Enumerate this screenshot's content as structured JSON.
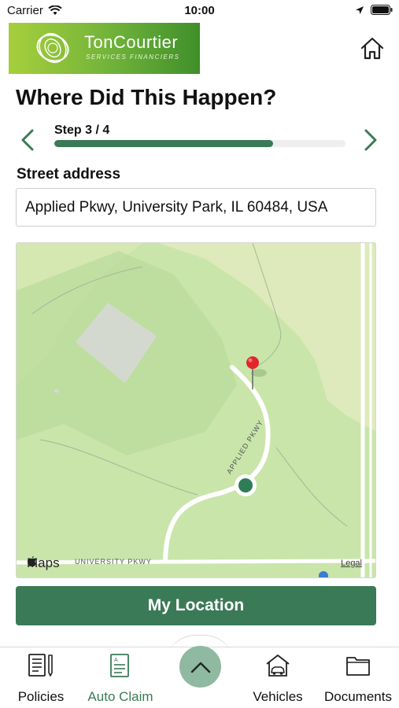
{
  "status_bar": {
    "carrier": "Carrier",
    "time": "10:00"
  },
  "header": {
    "logo_name": "TonCourtier",
    "logo_tagline": "SERVICES FINANCIERS"
  },
  "page": {
    "title": "Where Did This Happen?",
    "step_label": "Step 3 / 4",
    "progress_fraction": 0.75
  },
  "address": {
    "label": "Street address",
    "value": "Applied Pkwy, University Park, IL 60484, USA"
  },
  "map": {
    "provider_label": "Maps",
    "legal_label": "Legal",
    "road_labels": {
      "university": "UNIVERSITY PKWY",
      "applied": "APPLIED PKWY"
    }
  },
  "actions": {
    "my_location": "My Location"
  },
  "tab_bar": {
    "items": [
      {
        "label": "Policies",
        "icon": "policies-document-icon"
      },
      {
        "label": "Auto Claim",
        "icon": "auto-claim-form-icon",
        "active": true
      },
      {
        "label": "Vehicles",
        "icon": "vehicles-car-house-icon"
      },
      {
        "label": "Documents",
        "icon": "documents-folder-icon"
      }
    ],
    "center_icon": "chevron-up-icon"
  },
  "colors": {
    "accent": "#3b7a57",
    "map_park": "#c7e3a8",
    "pin": "#e0262b"
  }
}
